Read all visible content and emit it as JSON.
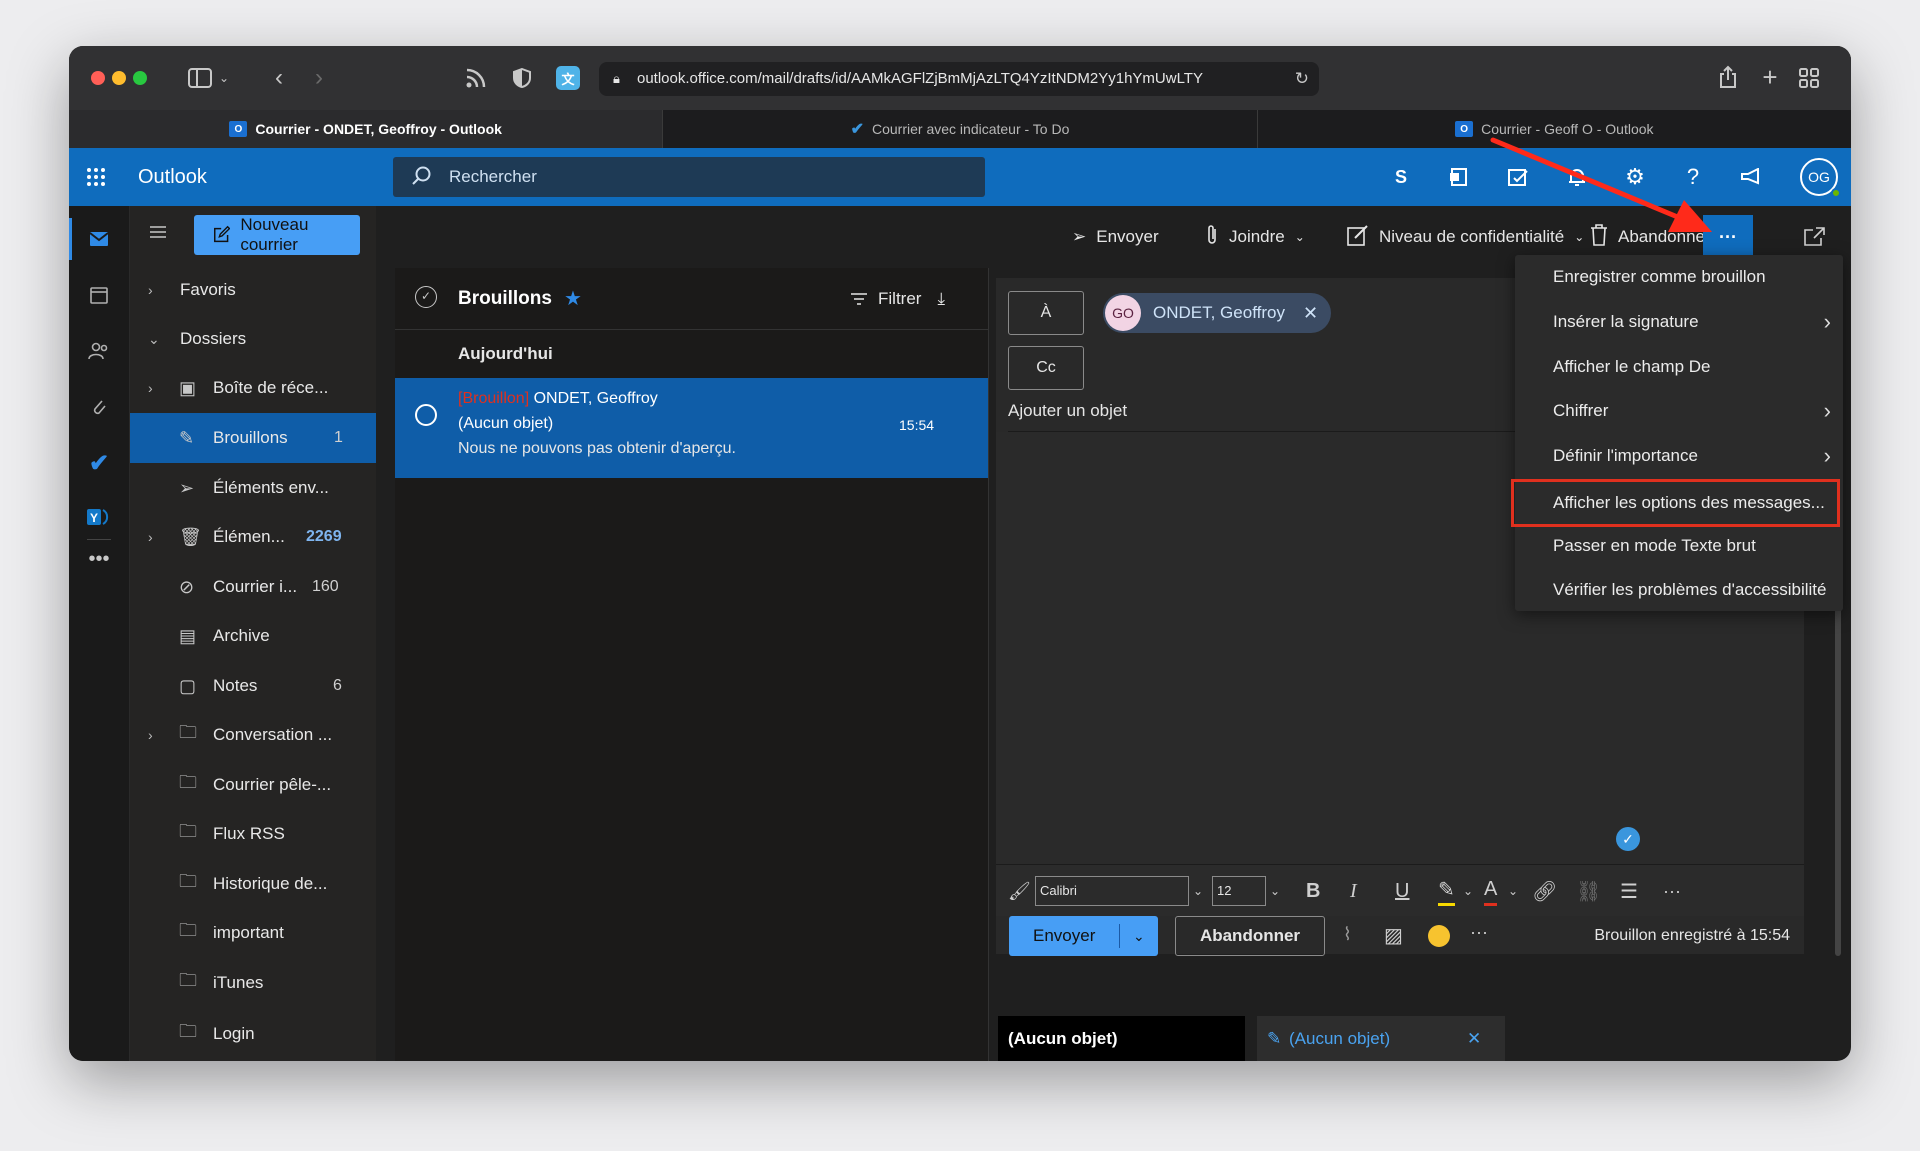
{
  "browser": {
    "url": "outlook.office.com/mail/drafts/id/AAMkAGFlZjBmMjAzLTQ4YzItNDM2Yy1hYmUwLTY",
    "tabs": [
      {
        "label": "Courrier - ONDET, Geoffroy - Outlook",
        "active": true
      },
      {
        "label": "Courrier avec indicateur - To Do",
        "active": false
      },
      {
        "label": "Courrier - Geoff O - Outlook",
        "active": false
      }
    ]
  },
  "header": {
    "app_name": "Outlook",
    "search_placeholder": "Rechercher",
    "avatar": "OG",
    "icons": [
      "skype-icon",
      "office-icon",
      "todo-icon",
      "bell-icon",
      "gear-icon",
      "help-icon",
      "feedback-icon"
    ]
  },
  "sidebar": {
    "new_mail": "Nouveau courrier",
    "favorites": "Favoris",
    "folders_label": "Dossiers",
    "items": [
      {
        "label": "Boîte de réce...",
        "count": ""
      },
      {
        "label": "Brouillons",
        "count": "1"
      },
      {
        "label": "Éléments env...",
        "count": ""
      },
      {
        "label": "Élémen...",
        "count": "2269"
      },
      {
        "label": "Courrier i...",
        "count": "160"
      },
      {
        "label": "Archive",
        "count": ""
      },
      {
        "label": "Notes",
        "count": "6"
      },
      {
        "label": "Conversation ...",
        "count": ""
      },
      {
        "label": "Courrier pêle-...",
        "count": ""
      },
      {
        "label": "Flux RSS",
        "count": ""
      },
      {
        "label": "Historique de...",
        "count": ""
      },
      {
        "label": "important",
        "count": ""
      },
      {
        "label": "iTunes",
        "count": ""
      },
      {
        "label": "Login",
        "count": ""
      }
    ]
  },
  "list": {
    "folder": "Brouillons",
    "filter": "Filtrer",
    "group": "Aujourd'hui",
    "message": {
      "tag": "[Brouillon]",
      "sender": "ONDET, Geoffroy",
      "subject": "(Aucun objet)",
      "preview": "Nous ne pouvons pas obtenir d'aperçu.",
      "time": "15:54"
    }
  },
  "commands": {
    "send": "Envoyer",
    "attach": "Joindre",
    "sensitivity": "Niveau de confidentialité",
    "discard": "Abandonner",
    "more": "···"
  },
  "compose": {
    "to_label": "À",
    "cc_label": "Cc",
    "recipient_initials": "GO",
    "recipient_name": "ONDET, Geoffroy",
    "subject_placeholder": "Ajouter un objet",
    "font": "Calibri",
    "size": "12",
    "send_button": "Envoyer",
    "discard_button": "Abandonner",
    "status": "Brouillon enregistré à 15:54"
  },
  "menu": {
    "items": [
      {
        "label": "Enregistrer comme brouillon",
        "submenu": false
      },
      {
        "label": "Insérer la signature",
        "submenu": true
      },
      {
        "label": "Afficher le champ De",
        "submenu": false
      },
      {
        "label": "Chiffrer",
        "submenu": true
      },
      {
        "label": "Définir l'importance",
        "submenu": true
      },
      {
        "label": "Afficher les options des messages...",
        "submenu": false,
        "highlighted": true
      },
      {
        "label": "Passer en mode Texte brut",
        "submenu": false
      },
      {
        "label": "Vérifier les problèmes d'accessibilité",
        "submenu": false
      }
    ]
  },
  "bottom_tabs": [
    {
      "label": "(Aucun objet)",
      "active": true
    },
    {
      "label": "(Aucun objet)",
      "active": false
    }
  ],
  "colors": {
    "accent": "#0f6cbd",
    "selection": "#0f5da8",
    "highlight_border": "#e0301e",
    "annotation_arrow": "#ff2a1a"
  }
}
